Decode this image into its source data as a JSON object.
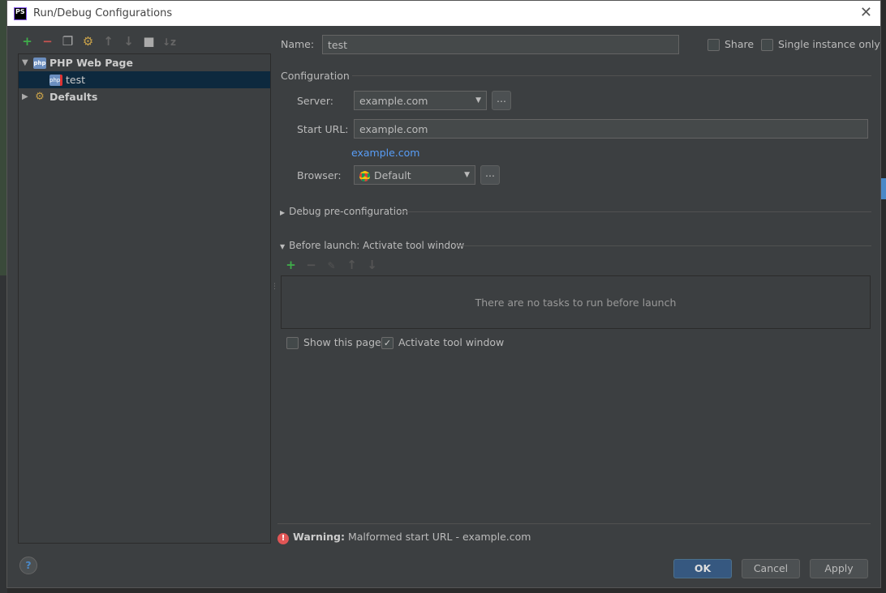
{
  "title": "Run/Debug Configurations",
  "toolbar": [
    "add-icon",
    "remove-icon",
    "copy-icon",
    "edit-defaults-icon",
    "move-up-icon",
    "move-down-icon",
    "folder-icon",
    "sort-icon"
  ],
  "tree": {
    "group": "PHP Web Page",
    "item": "test",
    "defaults": "Defaults"
  },
  "name": {
    "label": "Name:",
    "value": "test"
  },
  "share": "Share",
  "single_instance": "Single instance only",
  "configuration": "Configuration",
  "server": {
    "label": "Server:",
    "value": "example.com"
  },
  "start_url": {
    "label": "Start URL:",
    "value": "example.com",
    "link": "example.com"
  },
  "browser": {
    "label": "Browser:",
    "value": "Default"
  },
  "dots": "...",
  "debug_pre": "Debug pre-configuration",
  "before_launch": "Before launch: Activate tool window",
  "no_tasks": "There are no tasks to run before launch",
  "show_page": "Show this page",
  "activate": "Activate tool window",
  "warning": {
    "label": "Warning:",
    "text": "Malformed start URL - example.com"
  },
  "buttons": {
    "ok": "OK",
    "cancel": "Cancel",
    "apply": "Apply"
  },
  "help": "?"
}
